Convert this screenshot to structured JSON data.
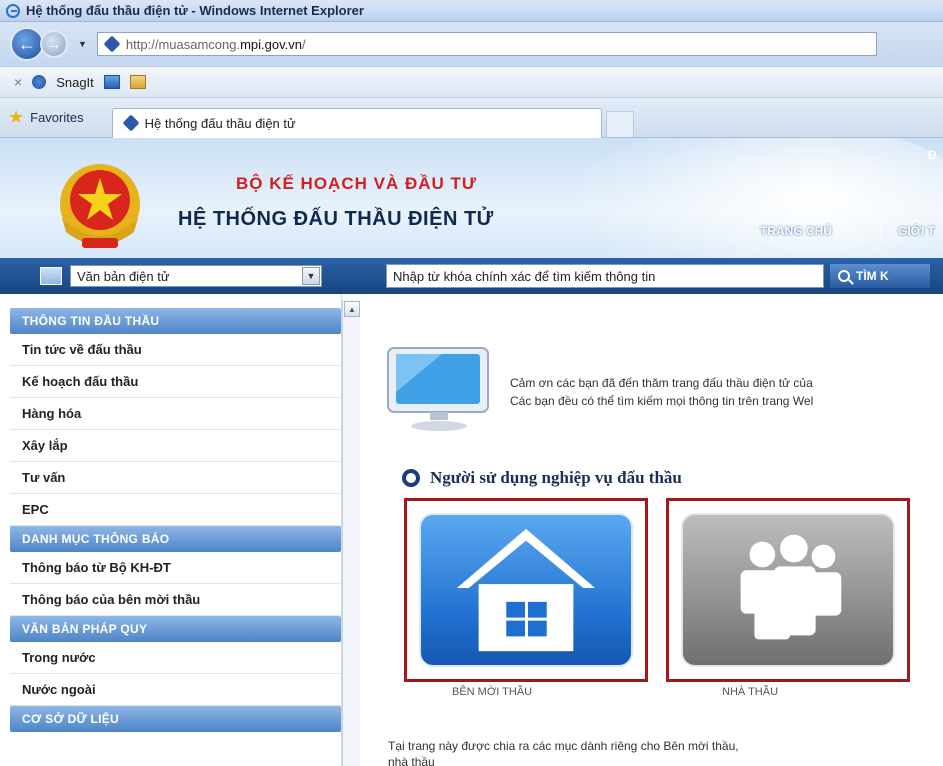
{
  "window": {
    "title": "Hệ thống đấu thầu điện tử - Windows Internet Explorer"
  },
  "address": {
    "url_prefix": "http://muasamcong.",
    "url_domain": "mpi.gov.vn",
    "url_suffix": "/"
  },
  "command_bar": {
    "close_glyph": "×",
    "snagit_label": "SnagIt"
  },
  "favorites_bar": {
    "favorites_label": "Favorites",
    "tab_title": "Hệ thống đấu thầu điện tử"
  },
  "header": {
    "ministry": "BỘ KẾ HOẠCH VÀ ĐẦU TƯ",
    "system_title": "HỆ THỐNG ĐẤU THẦU ĐIỆN TỬ",
    "nav_home": "TRANG CHỦ",
    "nav_about": "GIỚI T",
    "corner_letter": "Đ"
  },
  "search": {
    "category": "Văn bản điện tử",
    "placeholder": "Nhập từ khóa chính xác để tìm kiếm thông tin",
    "button": "TÌM K"
  },
  "sidebar": {
    "sections": [
      {
        "title": "THÔNG TIN ĐẦU THẦU",
        "items": [
          "Tin tức về đấu thầu",
          "Kế hoạch đấu thầu",
          "Hàng hóa",
          "Xây lắp",
          "Tư vấn",
          "EPC"
        ]
      },
      {
        "title": "DANH MỤC THÔNG BÁO",
        "items": [
          "Thông báo từ Bộ KH-ĐT",
          "Thông báo của bên mời thầu"
        ]
      },
      {
        "title": "VĂN BẢN PHÁP QUY",
        "items": [
          "Trong nước",
          "Nước ngoài"
        ]
      },
      {
        "title": "CƠ SỞ DỮ LIỆU",
        "items": []
      }
    ]
  },
  "main": {
    "welcome_line1": "Cảm ơn các bạn đã đến thăm trang đấu thầu điện tử của",
    "welcome_line2": "Các bạn đều có thể tìm kiếm mọi thông tin trên trang Wel",
    "section_title": "Người sử dụng nghiệp vụ đấu thầu",
    "tile_buyer": "BÊN MỜI THẦU",
    "tile_contractor": "NHÀ THẦU",
    "footer_line1": "Tại trang này được chia ra các mục dành riêng cho Bên mời thầu,",
    "footer_line2": "nhà thầu"
  }
}
